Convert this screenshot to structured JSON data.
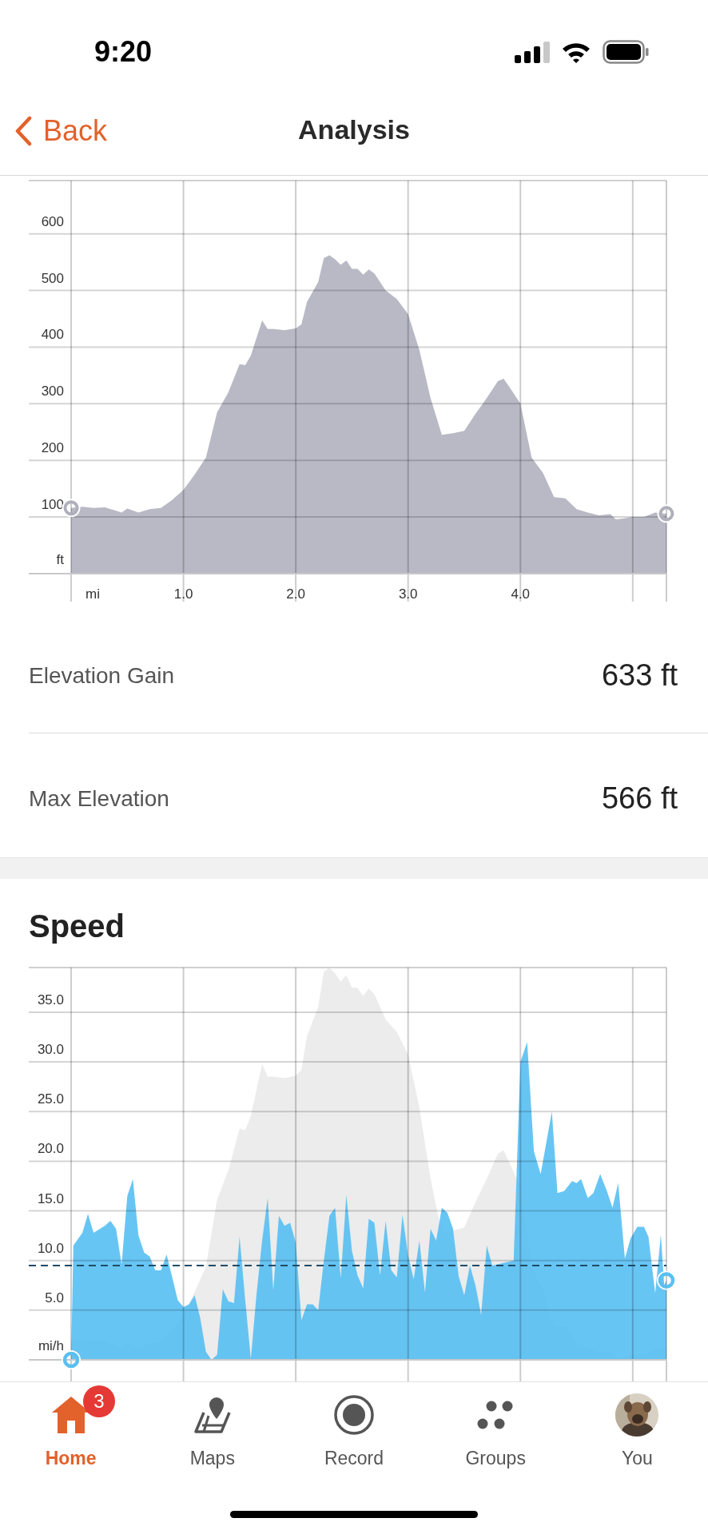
{
  "status_bar": {
    "time": "9:20"
  },
  "nav": {
    "back": "Back",
    "title": "Analysis"
  },
  "elevation": {
    "chart_data": {
      "type": "area",
      "xlabel": "mi",
      "ylabel": "ft",
      "xlim": [
        -0.377,
        5.3
      ],
      "ylim": [
        0,
        694
      ],
      "grid": true,
      "x": [
        0,
        0.1,
        0.2,
        0.3,
        0.4,
        0.45,
        0.5,
        0.6,
        0.7,
        0.8,
        0.9,
        1.0,
        1.1,
        1.2,
        1.3,
        1.4,
        1.5,
        1.55,
        1.6,
        1.7,
        1.75,
        1.8,
        1.9,
        2.0,
        2.05,
        2.1,
        2.2,
        2.25,
        2.3,
        2.35,
        2.4,
        2.45,
        2.5,
        2.55,
        2.6,
        2.65,
        2.7,
        2.8,
        2.9,
        3.0,
        3.1,
        3.2,
        3.3,
        3.4,
        3.5,
        3.6,
        3.7,
        3.8,
        3.85,
        3.9,
        4.0,
        4.1,
        4.2,
        4.3,
        4.4,
        4.5,
        4.6,
        4.7,
        4.8,
        4.85,
        4.9,
        5.0,
        5.1,
        5.2,
        5.3
      ],
      "series": [
        {
          "color": "#b9b9c5",
          "values": [
            116,
            118,
            116,
            117,
            111,
            108,
            115,
            108,
            114,
            116,
            130,
            148,
            175,
            205,
            285,
            320,
            370,
            368,
            385,
            447,
            432,
            432,
            430,
            433,
            440,
            480,
            515,
            557,
            562,
            555,
            545,
            553,
            538,
            538,
            528,
            537,
            530,
            500,
            485,
            458,
            395,
            310,
            245,
            248,
            252,
            282,
            310,
            340,
            344,
            330,
            300,
            205,
            178,
            135,
            133,
            114,
            108,
            103,
            105,
            96,
            97,
            100,
            100,
            108,
            106
          ]
        }
      ],
      "xticks": [
        {
          "value": 1,
          "label": "1.0"
        },
        {
          "value": 2,
          "label": "2.0"
        },
        {
          "value": 3,
          "label": "3.0"
        },
        {
          "value": 4,
          "label": "4.0"
        }
      ],
      "yticks": [
        100,
        200,
        300,
        400,
        500,
        600
      ]
    }
  },
  "stats": [
    {
      "label": "Elevation Gain",
      "value": "633 ft"
    },
    {
      "label": "Max Elevation",
      "value": "566 ft"
    }
  ],
  "speed": {
    "title": "Speed",
    "chart_data": {
      "type": "area",
      "ylabel": "mi/h",
      "xlim": [
        -0.377,
        5.3
      ],
      "ylim": [
        0,
        39.5
      ],
      "grid": true,
      "x": [
        0,
        0.02,
        0.1,
        0.15,
        0.2,
        0.3,
        0.35,
        0.4,
        0.45,
        0.5,
        0.55,
        0.6,
        0.65,
        0.7,
        0.75,
        0.8,
        0.85,
        0.9,
        0.95,
        1.0,
        1.05,
        1.1,
        1.15,
        1.2,
        1.25,
        1.3,
        1.35,
        1.4,
        1.45,
        1.5,
        1.55,
        1.6,
        1.65,
        1.7,
        1.75,
        1.8,
        1.85,
        1.9,
        1.95,
        2.0,
        2.05,
        2.1,
        2.15,
        2.2,
        2.25,
        2.3,
        2.35,
        2.4,
        2.45,
        2.5,
        2.55,
        2.6,
        2.65,
        2.7,
        2.75,
        2.8,
        2.85,
        2.9,
        2.95,
        3.0,
        3.05,
        3.1,
        3.15,
        3.2,
        3.25,
        3.3,
        3.35,
        3.4,
        3.45,
        3.5,
        3.55,
        3.6,
        3.65,
        3.7,
        3.75,
        3.94,
        4.0,
        4.06,
        4.12,
        4.18,
        4.28,
        4.33,
        4.39,
        4.46,
        4.5,
        4.54,
        4.6,
        4.65,
        4.71,
        4.77,
        4.82,
        4.87,
        4.93,
        4.98,
        5.04,
        5.1,
        5.14,
        5.2,
        5.25,
        5.28,
        5.3
      ],
      "series": [
        {
          "color": "#52bdf2",
          "values": [
            0,
            11.5,
            12.8,
            14.7,
            12.8,
            13.5,
            14.0,
            13.2,
            9.6,
            16.5,
            18.2,
            12.5,
            10.8,
            10.4,
            9.0,
            9.0,
            10.6,
            8.3,
            6.0,
            5.3,
            5.6,
            6.5,
            4.2,
            0.8,
            0,
            0.5,
            7.1,
            5.9,
            5.7,
            12.4,
            6,
            0.1,
            6.5,
            12,
            16.3,
            7,
            14.5,
            13.5,
            13.8,
            11.8,
            4,
            5.6,
            5.6,
            5,
            10,
            14.5,
            15.3,
            8.2,
            16.6,
            11,
            8.5,
            7.2,
            14.2,
            13.8,
            8.5,
            14,
            9,
            8.3,
            14.6,
            10.5,
            8.1,
            12,
            6.8,
            13.2,
            12,
            15.3,
            14.8,
            13.2,
            8.4,
            6.5,
            9.5,
            7.5,
            4.5,
            11.5,
            9.5,
            10,
            30,
            32,
            21,
            18.7,
            25,
            16.8,
            17,
            18,
            17.8,
            18.2,
            16.3,
            16.8,
            18.7,
            17,
            15.3,
            17.8,
            10.2,
            12.2,
            13.4,
            13.4,
            12.4,
            6.7,
            12.6,
            7.5,
            8
          ]
        }
      ],
      "yticks": [
        {
          "value": 5,
          "label": "5.0"
        },
        {
          "value": 10,
          "label": "10.0"
        },
        {
          "value": 15,
          "label": "15.0"
        },
        {
          "value": 20,
          "label": "20.0"
        },
        {
          "value": 25,
          "label": "25.0"
        },
        {
          "value": 30,
          "label": "30.0"
        },
        {
          "value": 35,
          "label": "35.0"
        }
      ],
      "ref_lines": [
        {
          "axis": "y",
          "value": 9.5
        }
      ]
    }
  },
  "tabs": [
    {
      "label": "Home",
      "kind": "home",
      "selected": true,
      "badge": "3"
    },
    {
      "label": "Maps",
      "kind": "maps",
      "selected": false
    },
    {
      "label": "Record",
      "kind": "record",
      "selected": false
    },
    {
      "label": "Groups",
      "kind": "groups",
      "selected": false
    },
    {
      "label": "You",
      "kind": "avatar",
      "selected": false
    }
  ]
}
